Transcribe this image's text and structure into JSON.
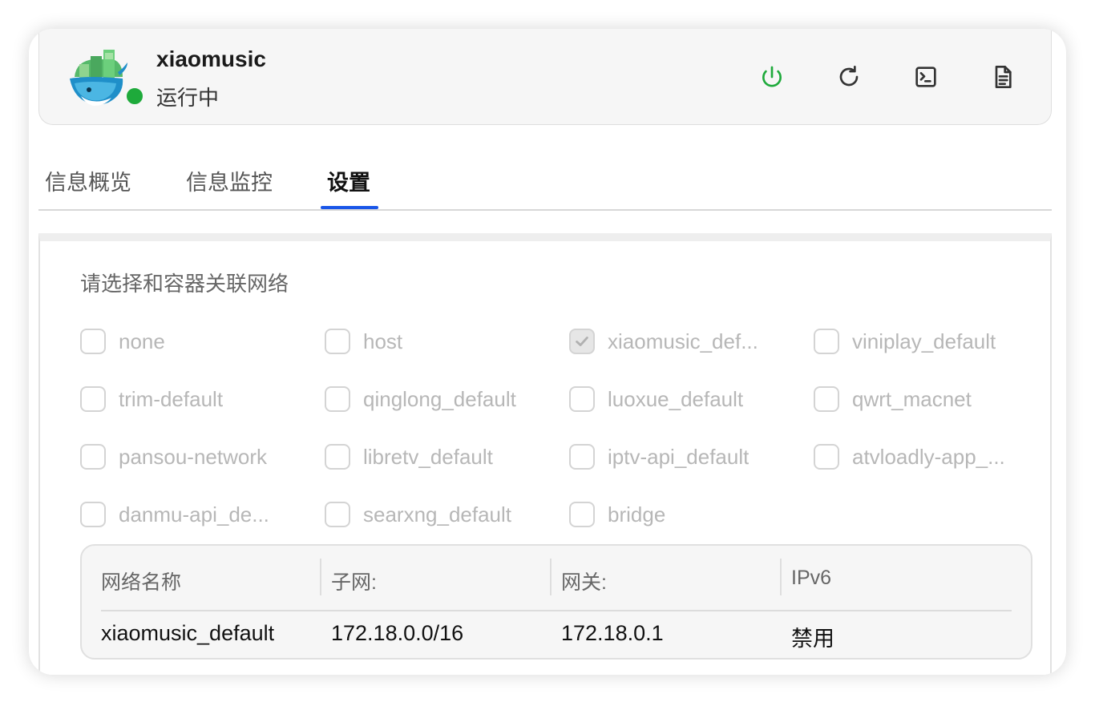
{
  "app": {
    "name": "xiaomusic",
    "status": "运行中",
    "status_color": "#1eaa3b"
  },
  "toolbar": {
    "power_icon": "power-icon",
    "restart_icon": "refresh-icon",
    "terminal_icon": "terminal-icon",
    "logs_icon": "document-icon",
    "power_color": "#1eaa3b"
  },
  "tabs": [
    {
      "label": "信息概览",
      "active": false
    },
    {
      "label": "信息监控",
      "active": false
    },
    {
      "label": "设置",
      "active": true
    }
  ],
  "accent_color": "#1a56e8",
  "network": {
    "title": "请选择和容器关联网络",
    "options": [
      {
        "label": "none",
        "checked": false
      },
      {
        "label": "host",
        "checked": false
      },
      {
        "label": "xiaomusic_def...",
        "checked": true
      },
      {
        "label": "viniplay_default",
        "checked": false
      },
      {
        "label": "trim-default",
        "checked": false
      },
      {
        "label": "qinglong_default",
        "checked": false
      },
      {
        "label": "luoxue_default",
        "checked": false
      },
      {
        "label": "qwrt_macnet",
        "checked": false
      },
      {
        "label": "pansou-network",
        "checked": false
      },
      {
        "label": "libretv_default",
        "checked": false
      },
      {
        "label": "iptv-api_default",
        "checked": false
      },
      {
        "label": "atvloadly-app_...",
        "checked": false
      },
      {
        "label": "danmu-api_de...",
        "checked": false
      },
      {
        "label": "searxng_default",
        "checked": false
      },
      {
        "label": "bridge",
        "checked": false
      }
    ],
    "table": {
      "headers": [
        "网络名称",
        "子网:",
        "网关:",
        "IPv6"
      ],
      "rows": [
        [
          "xiaomusic_default",
          "172.18.0.0/16",
          "172.18.0.1",
          "禁用"
        ]
      ]
    }
  }
}
